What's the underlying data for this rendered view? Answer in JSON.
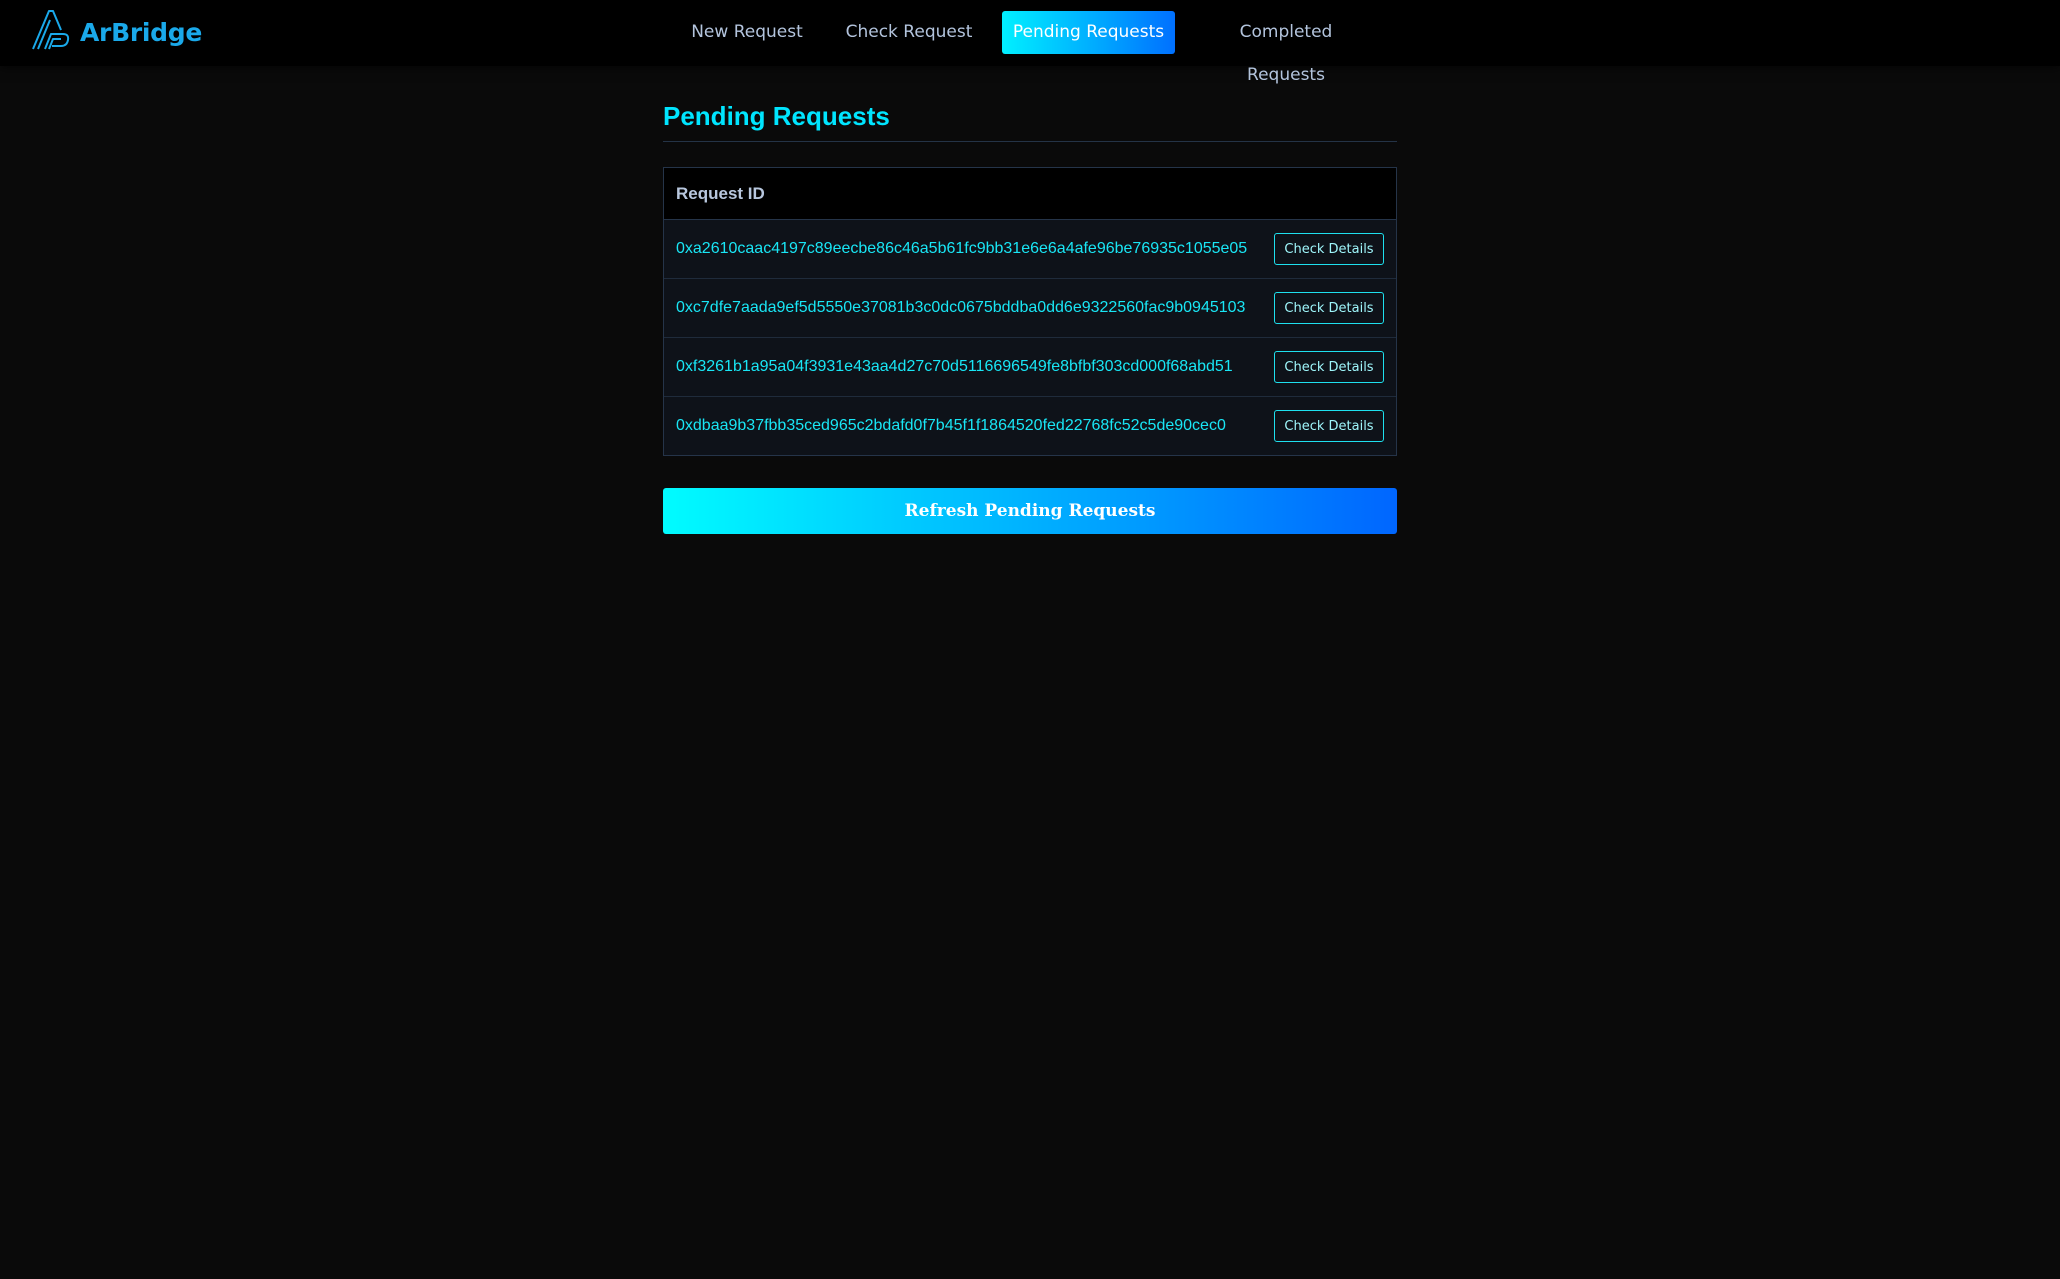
{
  "app": {
    "name": "ArBridge",
    "logo_icon": "arbridge-logo-icon"
  },
  "nav": {
    "items": [
      {
        "label": "New Request",
        "active": false
      },
      {
        "label": "Check Request",
        "active": false
      },
      {
        "label": "Pending Requests",
        "active": true
      },
      {
        "label": "Completed Requests",
        "active": false
      }
    ]
  },
  "page": {
    "title": "Pending Requests"
  },
  "table": {
    "header": "Request ID",
    "rows": [
      {
        "id": "0xa2610caac4197c89eecbe86c46a5b61fc9bb31e6e6a4afe96be76935c1055e05",
        "action": "Check Details"
      },
      {
        "id": "0xc7dfe7aada9ef5d5550e37081b3c0dc0675bddba0dd6e9322560fac9b0945103",
        "action": "Check Details"
      },
      {
        "id": "0xf3261b1a95a04f3931e43aa4d27c70d5116696549fe8bfbf303cd000f68abd51",
        "action": "Check Details"
      },
      {
        "id": "0xdbaa9b37fbb35ced965c2bdafd0f7b45f1f1864520fed22768fc52c5de90cec0",
        "action": "Check Details"
      }
    ]
  },
  "actions": {
    "refresh_label": "Refresh Pending Requests"
  },
  "colors": {
    "accent": "#00e5ff",
    "brand": "#1aa9ea",
    "gradient_start": "#00f0ff",
    "gradient_end": "#0066ff",
    "background": "#0a0a0a"
  }
}
